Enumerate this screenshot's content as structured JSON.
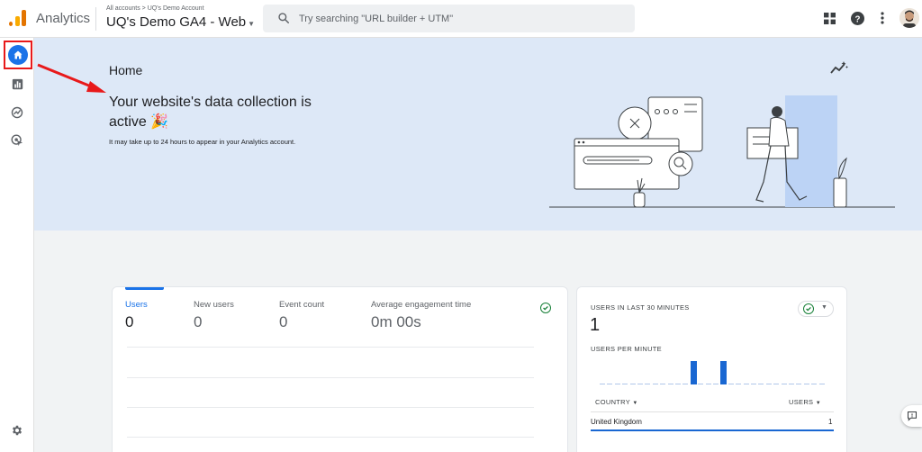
{
  "header": {
    "app_name": "Analytics",
    "breadcrumb": "All accounts > UQ's Demo Account",
    "property_name": "UQ's Demo GA4 - Web",
    "search_placeholder": "Try searching \"URL builder + UTM\""
  },
  "sidebar": {
    "items": [
      {
        "name": "home",
        "icon": "home-icon",
        "selected": true
      },
      {
        "name": "reports",
        "icon": "bar-chart-icon"
      },
      {
        "name": "explore",
        "icon": "explore-icon"
      },
      {
        "name": "advertising",
        "icon": "advertising-icon"
      }
    ],
    "settings_icon": "gear-icon"
  },
  "hero": {
    "title": "Home",
    "heading": "Your website's data collection is active 🎉",
    "subtext": "It may take up to 24 hours to appear in your Analytics account."
  },
  "overview": {
    "metrics": [
      {
        "label": "Users",
        "value": "0"
      },
      {
        "label": "New users",
        "value": "0"
      },
      {
        "label": "Event count",
        "value": "0"
      },
      {
        "label": "Average engagement time",
        "value": "0m 00s"
      }
    ]
  },
  "realtime": {
    "title": "USERS IN LAST 30 MINUTES",
    "value": "1",
    "per_minute_label": "USERS PER MINUTE",
    "bars": [
      0,
      0,
      0,
      0,
      0,
      0,
      0,
      0,
      0,
      0,
      0,
      0,
      0,
      0,
      0,
      0,
      0,
      0,
      1,
      0,
      0,
      0,
      0,
      0,
      0,
      0,
      0,
      0,
      0,
      0
    ],
    "bar_peak_minutes": [
      12,
      16
    ],
    "col_country": "COUNTRY",
    "col_users": "USERS",
    "rows": [
      {
        "country": "United Kingdom",
        "users": "1"
      }
    ]
  },
  "colors": {
    "accent": "#1a73e8",
    "hero_bg": "#dde8f7",
    "highlight_box": "#e8191a",
    "check_green": "#188038"
  }
}
